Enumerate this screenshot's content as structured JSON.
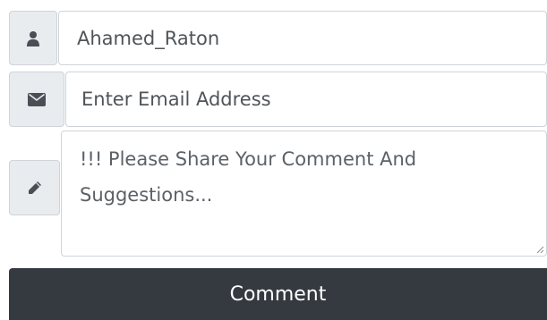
{
  "form": {
    "name_field": {
      "value": "Ahamed_Raton",
      "icon": "user-icon"
    },
    "email_field": {
      "placeholder": "Enter Email Address",
      "icon": "envelope-icon"
    },
    "comment_field": {
      "placeholder_line1": "!!! Please Share Your Comment And",
      "placeholder_line2": "Suggestions...",
      "icon": "pencil-icon"
    },
    "submit_button": {
      "label": "Comment"
    }
  },
  "colors": {
    "addon_background": "#e9ecef",
    "border": "#ced4da",
    "button_background": "#343a40",
    "button_text": "#ffffff",
    "icon": "#4a4f55"
  }
}
